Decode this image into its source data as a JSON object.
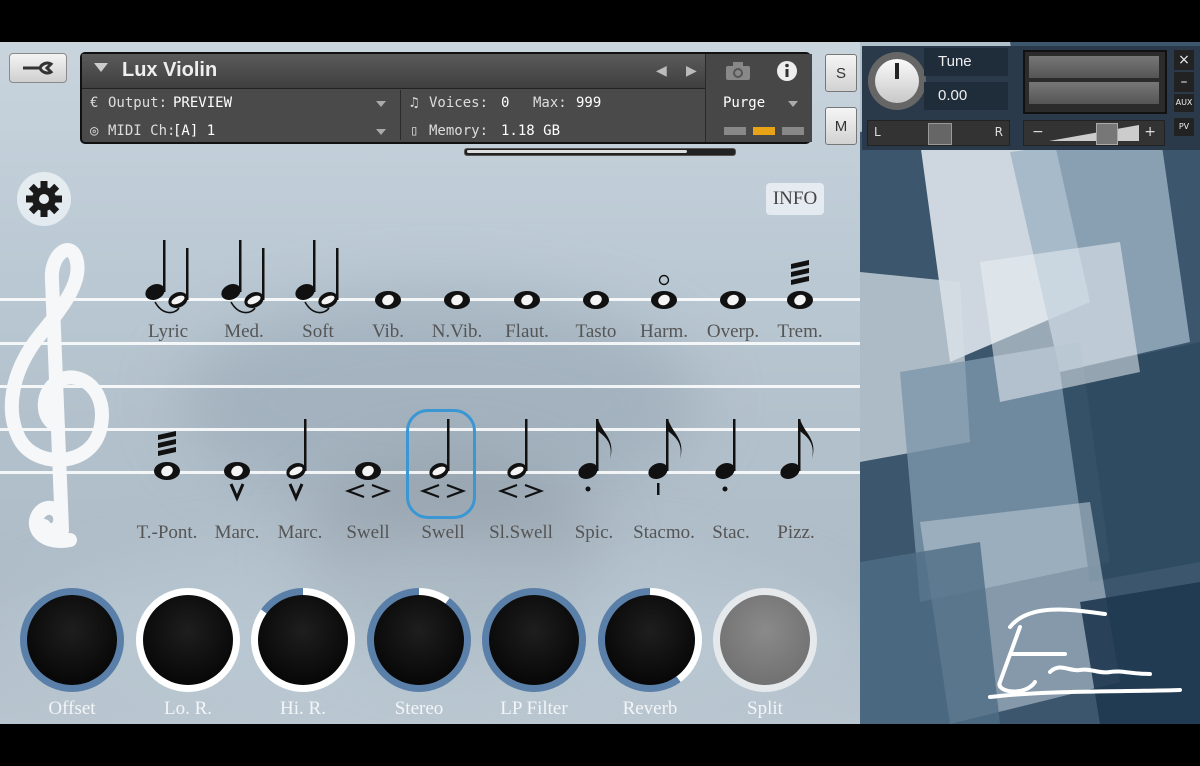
{
  "header": {
    "instrument_name": "Lux Violin",
    "output_label": "Output:",
    "output_value": "PREVIEW",
    "midi_label": "MIDI Ch:",
    "midi_value": "[A]  1",
    "voices_label": "Voices:",
    "voices_value": "0",
    "max_label": "Max:",
    "max_value": "999",
    "memory_label": "Memory:",
    "memory_value": "1.18 GB",
    "purge_label": "Purge",
    "solo_label": "S",
    "mute_label": "M"
  },
  "mixer": {
    "tune_label": "Tune",
    "tune_value": "0.00",
    "pan_left": "L",
    "pan_right": "R",
    "vol_minus": "−",
    "vol_plus": "+",
    "aux_label": "AUX",
    "pv_label": "PV",
    "close_label": "×",
    "min_label": "–"
  },
  "info_button": "INFO",
  "articulations_row1": [
    {
      "label": "Lyric",
      "symbol": "half-quarter-tie"
    },
    {
      "label": "Med.",
      "symbol": "half-quarter-tie"
    },
    {
      "label": "Soft",
      "symbol": "half-quarter-tie"
    },
    {
      "label": "Vib.",
      "symbol": "whole"
    },
    {
      "label": "N.Vib.",
      "symbol": "whole"
    },
    {
      "label": "Flaut.",
      "symbol": "whole"
    },
    {
      "label": "Tasto",
      "symbol": "whole"
    },
    {
      "label": "Harm.",
      "symbol": "whole-harmonic"
    },
    {
      "label": "Overp.",
      "symbol": "whole"
    },
    {
      "label": "Trem.",
      "symbol": "whole-tremolo"
    }
  ],
  "articulations_row2": [
    {
      "label": "T.-Pont.",
      "symbol": "whole-tremolo"
    },
    {
      "label": "Marc.",
      "symbol": "whole-marcato"
    },
    {
      "label": "Marc.",
      "symbol": "half-marcato"
    },
    {
      "label": "Swell",
      "symbol": "whole-swell"
    },
    {
      "label": "Swell",
      "symbol": "half-swell",
      "selected": true
    },
    {
      "label": "Sl.Swell",
      "symbol": "half-swell"
    },
    {
      "label": "Spic.",
      "symbol": "eighth-dot"
    },
    {
      "label": "Stacmo.",
      "symbol": "eighth-wedge"
    },
    {
      "label": "Stac.",
      "symbol": "quarter-dot"
    },
    {
      "label": "Pizz.",
      "symbol": "eighth"
    }
  ],
  "knobs": [
    {
      "label": "Offset",
      "value": 0.0
    },
    {
      "label": "Lo. R.",
      "value": 1.0
    },
    {
      "label": "Hi. R.",
      "value": 0.85
    },
    {
      "label": "Stereo",
      "value": 0.1
    },
    {
      "label": "LP Filter",
      "value": 0.0
    },
    {
      "label": "Reverb",
      "value": 0.4
    },
    {
      "label": "Split",
      "value": 1.0,
      "disabled": true
    }
  ],
  "colors": {
    "selected_outline": "#3a97d4",
    "knob_track": "#5a7fa8",
    "knob_fill": "#ffffff",
    "accent_orange": "#e8a317"
  }
}
